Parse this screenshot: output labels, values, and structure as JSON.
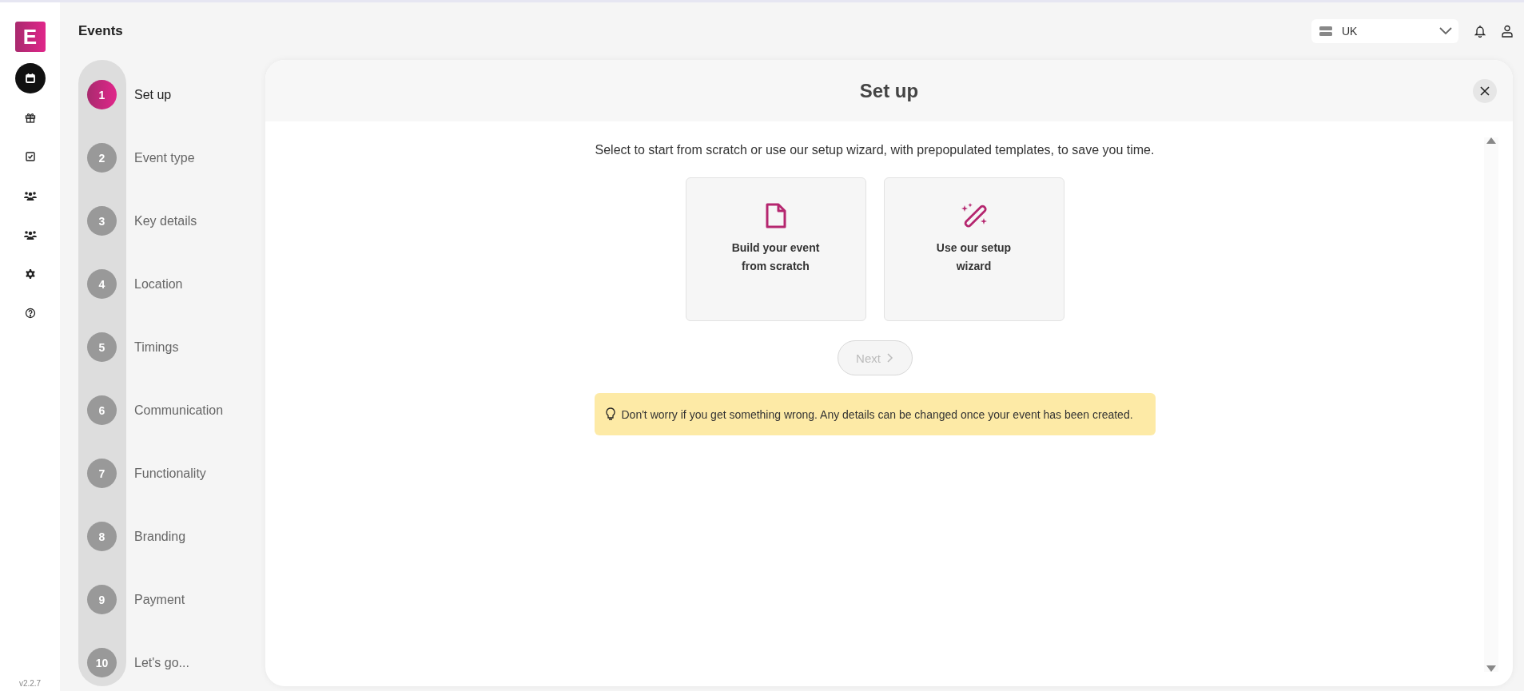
{
  "app": {
    "logo": "E",
    "title": "Events",
    "version": "v2.2.7"
  },
  "nav": [
    {
      "kind": "calendar",
      "selected": true
    },
    {
      "kind": "gift",
      "selected": false
    },
    {
      "kind": "checkbox",
      "selected": false
    },
    {
      "kind": "group",
      "selected": false
    },
    {
      "kind": "group",
      "selected": false
    },
    {
      "kind": "settings",
      "selected": false
    },
    {
      "kind": "help",
      "selected": false
    }
  ],
  "region_select": {
    "value": "UK"
  },
  "steps": [
    {
      "number": "1",
      "label": "Set up",
      "selected": true
    },
    {
      "number": "2",
      "label": "Event type",
      "selected": false
    },
    {
      "number": "3",
      "label": "Key details",
      "selected": false
    },
    {
      "number": "4",
      "label": "Location",
      "selected": false
    },
    {
      "number": "5",
      "label": "Timings",
      "selected": false
    },
    {
      "number": "6",
      "label": "Communication",
      "selected": false
    },
    {
      "number": "7",
      "label": "Functionality",
      "selected": false
    },
    {
      "number": "8",
      "label": "Branding",
      "selected": false
    },
    {
      "number": "9",
      "label": "Payment",
      "selected": false
    },
    {
      "number": "10",
      "label": "Let's go...",
      "selected": false
    }
  ],
  "dialog": {
    "title": "Set up",
    "intro": "Select to start from scratch or use our setup wizard, with prepopulated templates, to save you time.",
    "options": [
      {
        "kind": "document",
        "label": "Build your event from scratch",
        "selected": false
      },
      {
        "kind": "wand",
        "label": "Use our setup wizard",
        "selected": false
      }
    ],
    "next_button": {
      "label": "Next",
      "disabled": true
    },
    "tip": "Don't worry if you get something wrong. Any details can be changed once your event has been created."
  }
}
